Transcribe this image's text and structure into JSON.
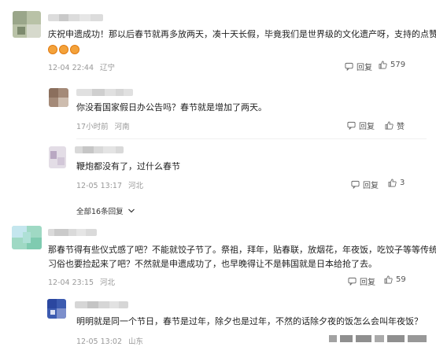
{
  "comments": [
    {
      "text": "庆祝申遗成功！那以后春节就再多放两天，凑十天长假，毕竟我们是世界级的文化遗产呀，支持的点赞",
      "time": "12-04 22:44",
      "location": "辽宁",
      "reply_label": "回复",
      "like_count": "579"
    },
    {
      "text": "你没看国家假日办公告吗？春节就是增加了两天。",
      "time": "17小时前",
      "location": "河南",
      "reply_label": "回复",
      "like_label": "赞"
    },
    {
      "text": "鞭炮都没有了，过什么春节",
      "time": "12-05 13:17",
      "location": "河北",
      "reply_label": "回复",
      "like_count": "3"
    },
    {
      "text_line1": "那春节得有些仪式感了吧？不能就饺子节了。祭祖，拜年，贴春联，放烟花，年夜饭，吃饺子等等传统",
      "text_line2": "习俗也要捡起来了吧？不然就是申遗成功了，也早晚得让不是韩国就是日本给抢了去。",
      "time": "12-04 23:15",
      "location": "河北",
      "reply_label": "回复",
      "like_count": "59"
    },
    {
      "text": "明明就是同一个节日，春节是过年，除夕也是过年，不然的话除夕夜的饭怎么会叫年夜饭？",
      "time": "12-05 13:02",
      "location": "山东"
    }
  ],
  "show_all_replies": "全部16条回复",
  "colors": {
    "meta": "#999999",
    "text": "#222222",
    "emoji": "#f4a23a"
  },
  "icons": [
    "reply-icon",
    "thumbs-up-icon",
    "chevron-down-icon"
  ]
}
